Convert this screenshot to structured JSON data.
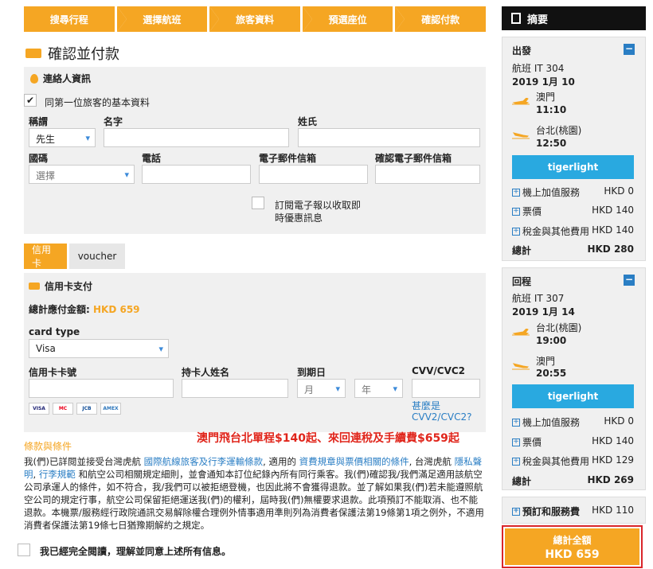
{
  "steps": [
    "搜尋行程",
    "選擇航班",
    "旅客資料",
    "預選座位",
    "確認付款"
  ],
  "page_title": "確認並付款",
  "contact": {
    "section_title": "連絡人資訊",
    "same_as_first": "同第一位旅客的基本資料",
    "title_label": "稱謂",
    "title_value": "先生",
    "first_name_label": "名字",
    "last_name_label": "姓氏",
    "country_label": "國碼",
    "country_placeholder": "選擇",
    "phone_label": "電話",
    "email_label": "電子郵件信箱",
    "confirm_email_label": "確認電子郵件信箱",
    "newsletter_line1": "訂閱電子報以收取即",
    "newsletter_line2": "時優惠訊息"
  },
  "payment_tabs": [
    "信用卡",
    "voucher"
  ],
  "card": {
    "section_title": "信用卡支付",
    "total_label": "總計應付金額:",
    "total_value": "HKD 659",
    "card_type_label": "card type",
    "card_type_value": "Visa",
    "card_no_label": "信用卡卡號",
    "holder_label": "持卡人姓名",
    "expiry_label": "到期日",
    "month_placeholder": "月",
    "year_placeholder": "年",
    "cvv_label": "CVV/CVC2",
    "cvv_link_1": "甚麼是",
    "cvv_link_2": "CVV2/CVC2?",
    "brands": [
      "VISA",
      "MC",
      "JCB",
      "AMEX"
    ]
  },
  "promo_text": "澳門飛台北單程$140起、來回連稅及手續費$659起",
  "terms_title": "條款與條件",
  "terms": {
    "t1": "我(們)已詳閱並接受台灣虎航 ",
    "l1": "國際航線旅客及行李運輸條款",
    "t2": ", 適用的 ",
    "l2": "資費規章與票價相關的條件",
    "t3": ", 台灣虎航 ",
    "l3": "隱私聲明",
    "t4": ", ",
    "l4": "行李規範",
    "t5": " 和航空公司相關規定細則，並會通知本訂位紀錄內所有同行乘客。我(們)確認我/我們滿足適用該航空公司承運人的條件，如不符合，我/我們可以被拒絕登機，也因此將不會獲得退款。並了解如果我(們)若未能遵照航空公司的規定行事，航空公司保留拒絕運送我(們)的權利，屆時我(們)無權要求退款。此項預訂不能取消、也不能退款。本機票/服務經行政院通訊交易解除權合理例外情事適用準則列為消費者保護法第19條第1項之例外，不適用消費者保護法第19條七日猶豫期解約之規定。"
  },
  "agree_text": "我已經完全閱讀，理解並同意上述所有信息。",
  "summary": {
    "title": "摘要",
    "depart": {
      "heading": "出發",
      "flight": "航班 IT 304",
      "date": "2019 1月 10",
      "from": "澳門",
      "from_time": "11:10",
      "to": "台北(桃園)",
      "to_time": "12:50",
      "fare": "tigerlight",
      "fees": [
        {
          "label": "機上加值服務",
          "value": "HKD 0"
        },
        {
          "label": "票價",
          "value": "HKD 140"
        },
        {
          "label": "稅金與其他費用",
          "value": "HKD 140"
        }
      ],
      "total_label": "總計",
      "total_value": "HKD 280"
    },
    "return": {
      "heading": "回程",
      "flight": "航班 IT 307",
      "date": "2019 1月 14",
      "from": "台北(桃園)",
      "from_time": "19:00",
      "to": "澳門",
      "to_time": "20:55",
      "fare": "tigerlight",
      "fees": [
        {
          "label": "機上加值服務",
          "value": "HKD 0"
        },
        {
          "label": "票價",
          "value": "HKD 140"
        },
        {
          "label": "稅金與其他費用",
          "value": "HKD 129"
        }
      ],
      "total_label": "總計",
      "total_value": "HKD 269"
    },
    "booking_fee_label": "預訂和服務費",
    "booking_fee_value": "HKD 110",
    "grand_total_label": "總計全額",
    "grand_total_value": "HKD 659"
  },
  "colors": {
    "accent": "#f5a623",
    "fare_blue": "#29a9e0",
    "promo_red": "#e0251b"
  }
}
